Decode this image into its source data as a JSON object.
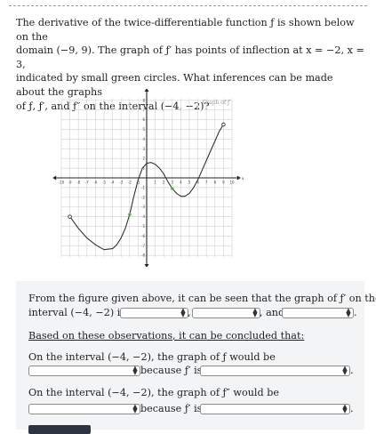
{
  "question": {
    "line1": "The derivative of the twice-differentiable function ƒ is shown below on the",
    "line2": "domain (−9, 9). The graph of ƒ′ has points of inflection at x = −2, x = 3,",
    "line3": "indicated by small green circles. What inferences can be made about the graphs",
    "line4": "of ƒ, ƒ′, and ƒ″ on the interval (−4, −2)?"
  },
  "graph": {
    "legend": "Graph of ƒ′",
    "y_axis_letter": "y",
    "x_axis_letter": "x",
    "x_ticks": [
      "-10",
      "-9",
      "-8",
      "-7",
      "-6",
      "-5",
      "-4",
      "-3",
      "-2",
      "-1",
      "1",
      "2",
      "3",
      "4",
      "5",
      "6",
      "7",
      "8",
      "9",
      "10"
    ],
    "y_ticks": [
      "8",
      "7",
      "6",
      "5",
      "4",
      "3",
      "2",
      "1",
      "-1",
      "-2",
      "-3",
      "-4",
      "-5",
      "-6",
      "-7",
      "-8"
    ],
    "curve_color": "#333333",
    "inflection_color": "#7cc576",
    "open_circle_color": "#333333"
  },
  "chart_data": {
    "type": "line",
    "title": "Graph of ƒ′",
    "xlabel": "x",
    "ylabel": "y",
    "xlim": [
      -10,
      10
    ],
    "ylim": [
      -8,
      8
    ],
    "series": [
      {
        "x": [
          -9,
          -8,
          -7,
          -6,
          -5,
          -4,
          -3.5,
          -3,
          -2.5,
          -2,
          -1.5,
          -1,
          -0.5,
          0,
          0.5,
          1,
          1.5,
          2,
          2.5,
          3,
          3.5,
          4,
          4.5,
          5,
          5.5,
          6,
          6.5,
          7,
          7.5,
          8,
          8.5,
          9
        ],
        "values": [
          -4,
          -5.2,
          -6.2,
          -6.9,
          -7.4,
          -7.3,
          -6.9,
          -6.2,
          -5.2,
          -3.8,
          -1.9,
          -0.2,
          1,
          1.5,
          1.6,
          1.4,
          1,
          0.4,
          -0.4,
          -1.1,
          -1.6,
          -1.9,
          -1.9,
          -1.6,
          -1,
          -0.2,
          0.8,
          1.8,
          2.8,
          3.8,
          4.8,
          5.5
        ]
      }
    ],
    "open_endpoints": [
      [
        -9,
        -4
      ],
      [
        9,
        5.5
      ]
    ],
    "inflection_points": [
      [
        -2,
        -3.8
      ],
      [
        3,
        -1.1
      ]
    ],
    "grid": true
  },
  "panel": {
    "line1_a": "From the figure given above, it can be seen that the graph of ƒ′ on the",
    "line2_a": "interval (−4, −2) is",
    "line2_sep": ",",
    "line2_and": ", and",
    "line2_end": ".",
    "conclude": "Based on these observations, it can be concluded that:",
    "q1_line": "On the interval (−4, −2), the graph of ƒ would be",
    "q1_because": "because ƒ′ is",
    "q1_end": ".",
    "q2_line": "On the interval (−4, −2), the graph of ƒ″ would be",
    "q2_because": "because ƒ′ is",
    "q2_end": ".",
    "dropdown_value": ""
  }
}
